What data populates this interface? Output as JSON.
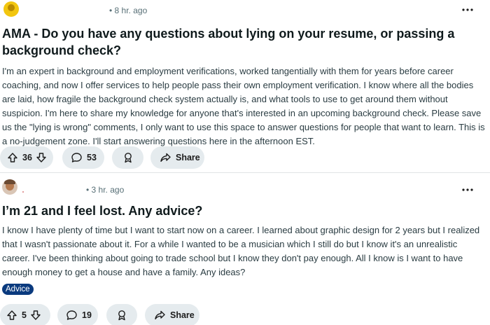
{
  "posts": [
    {
      "time": "• 8 hr. ago",
      "title": "AMA - Do you have any questions about lying on your resume, or passing a background check?",
      "body": "I'm an expert in background and employment verifications, worked tangentially with them for years before career coaching, and now I offer services to help people pass their own employment verification. I know where all the bodies are laid, how fragile the background check system actually is, and what tools to use to get around them without suspicion. I'm here to share my knowledge for anyone that's interested in an upcoming background check. Please save us the \"lying is wrong\" comments, I only want to use this space to answer questions for people that want to learn. This is a no-judgement zone. I'll start answering questions here in the afternoon EST.",
      "votes": "36",
      "comments": "53",
      "share_label": "Share",
      "icons": [
        "upvote-icon",
        "downvote-icon",
        "comment-icon",
        "award-icon",
        "share-icon",
        "more-options-icon"
      ]
    },
    {
      "time": "• 3 hr. ago",
      "title": "I’m 21 and I feel lost. Any advice?",
      "body": "I know I have plenty of time but I want to start now on a career. I learned about graphic design for 2 years but I realized that I wasn't passionate about it. For a while I wanted to be a musician which I still do but I know it's an unrealistic career. I've been thinking about going to trade school but I know they don't pay enough. All I know is I want to have enough money to get a house and have a family. Any ideas?",
      "flair": "Advice",
      "votes": "5",
      "comments": "19",
      "share_label": "Share",
      "icons": [
        "upvote-icon",
        "downvote-icon",
        "comment-icon",
        "award-icon",
        "share-icon",
        "more-options-icon"
      ]
    }
  ],
  "colors": {
    "pill_bg": "#e5ebee",
    "flair_bg": "#0a3a7e",
    "meta_text": "#576f76",
    "title_text": "#0f1a1c",
    "body_text": "#2a3c42"
  }
}
